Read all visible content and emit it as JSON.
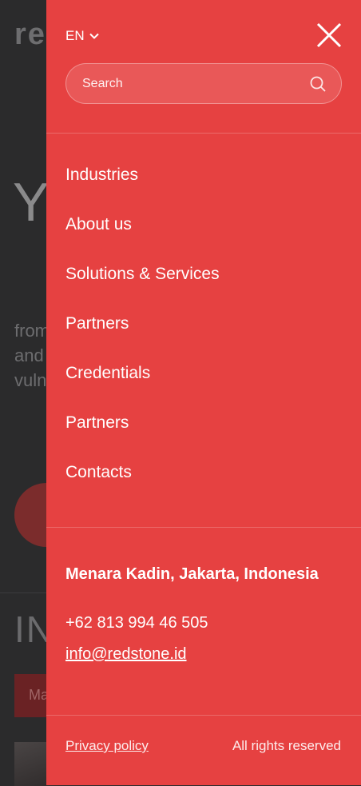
{
  "background": {
    "logo": "re",
    "hero": "Y",
    "text_lines": [
      "from",
      "and",
      "vuln"
    ],
    "heading": "IN",
    "tag": "Ma"
  },
  "drawer": {
    "language": "EN",
    "search": {
      "placeholder": "Search"
    },
    "nav": [
      {
        "label": "Industries"
      },
      {
        "label": "About us"
      },
      {
        "label": "Solutions & Services"
      },
      {
        "label": "Partners"
      },
      {
        "label": "Credentials"
      },
      {
        "label": "Partners"
      },
      {
        "label": "Contacts"
      }
    ],
    "contact": {
      "address": "Menara Kadin, Jakarta, Indonesia",
      "phone": "+62 813 994 46 505",
      "email": "info@redstone.id"
    },
    "footer": {
      "privacy": "Privacy policy",
      "rights": "All rights reserved"
    }
  },
  "colors": {
    "accent": "#e64141",
    "backdrop": "#2b2b2c"
  }
}
